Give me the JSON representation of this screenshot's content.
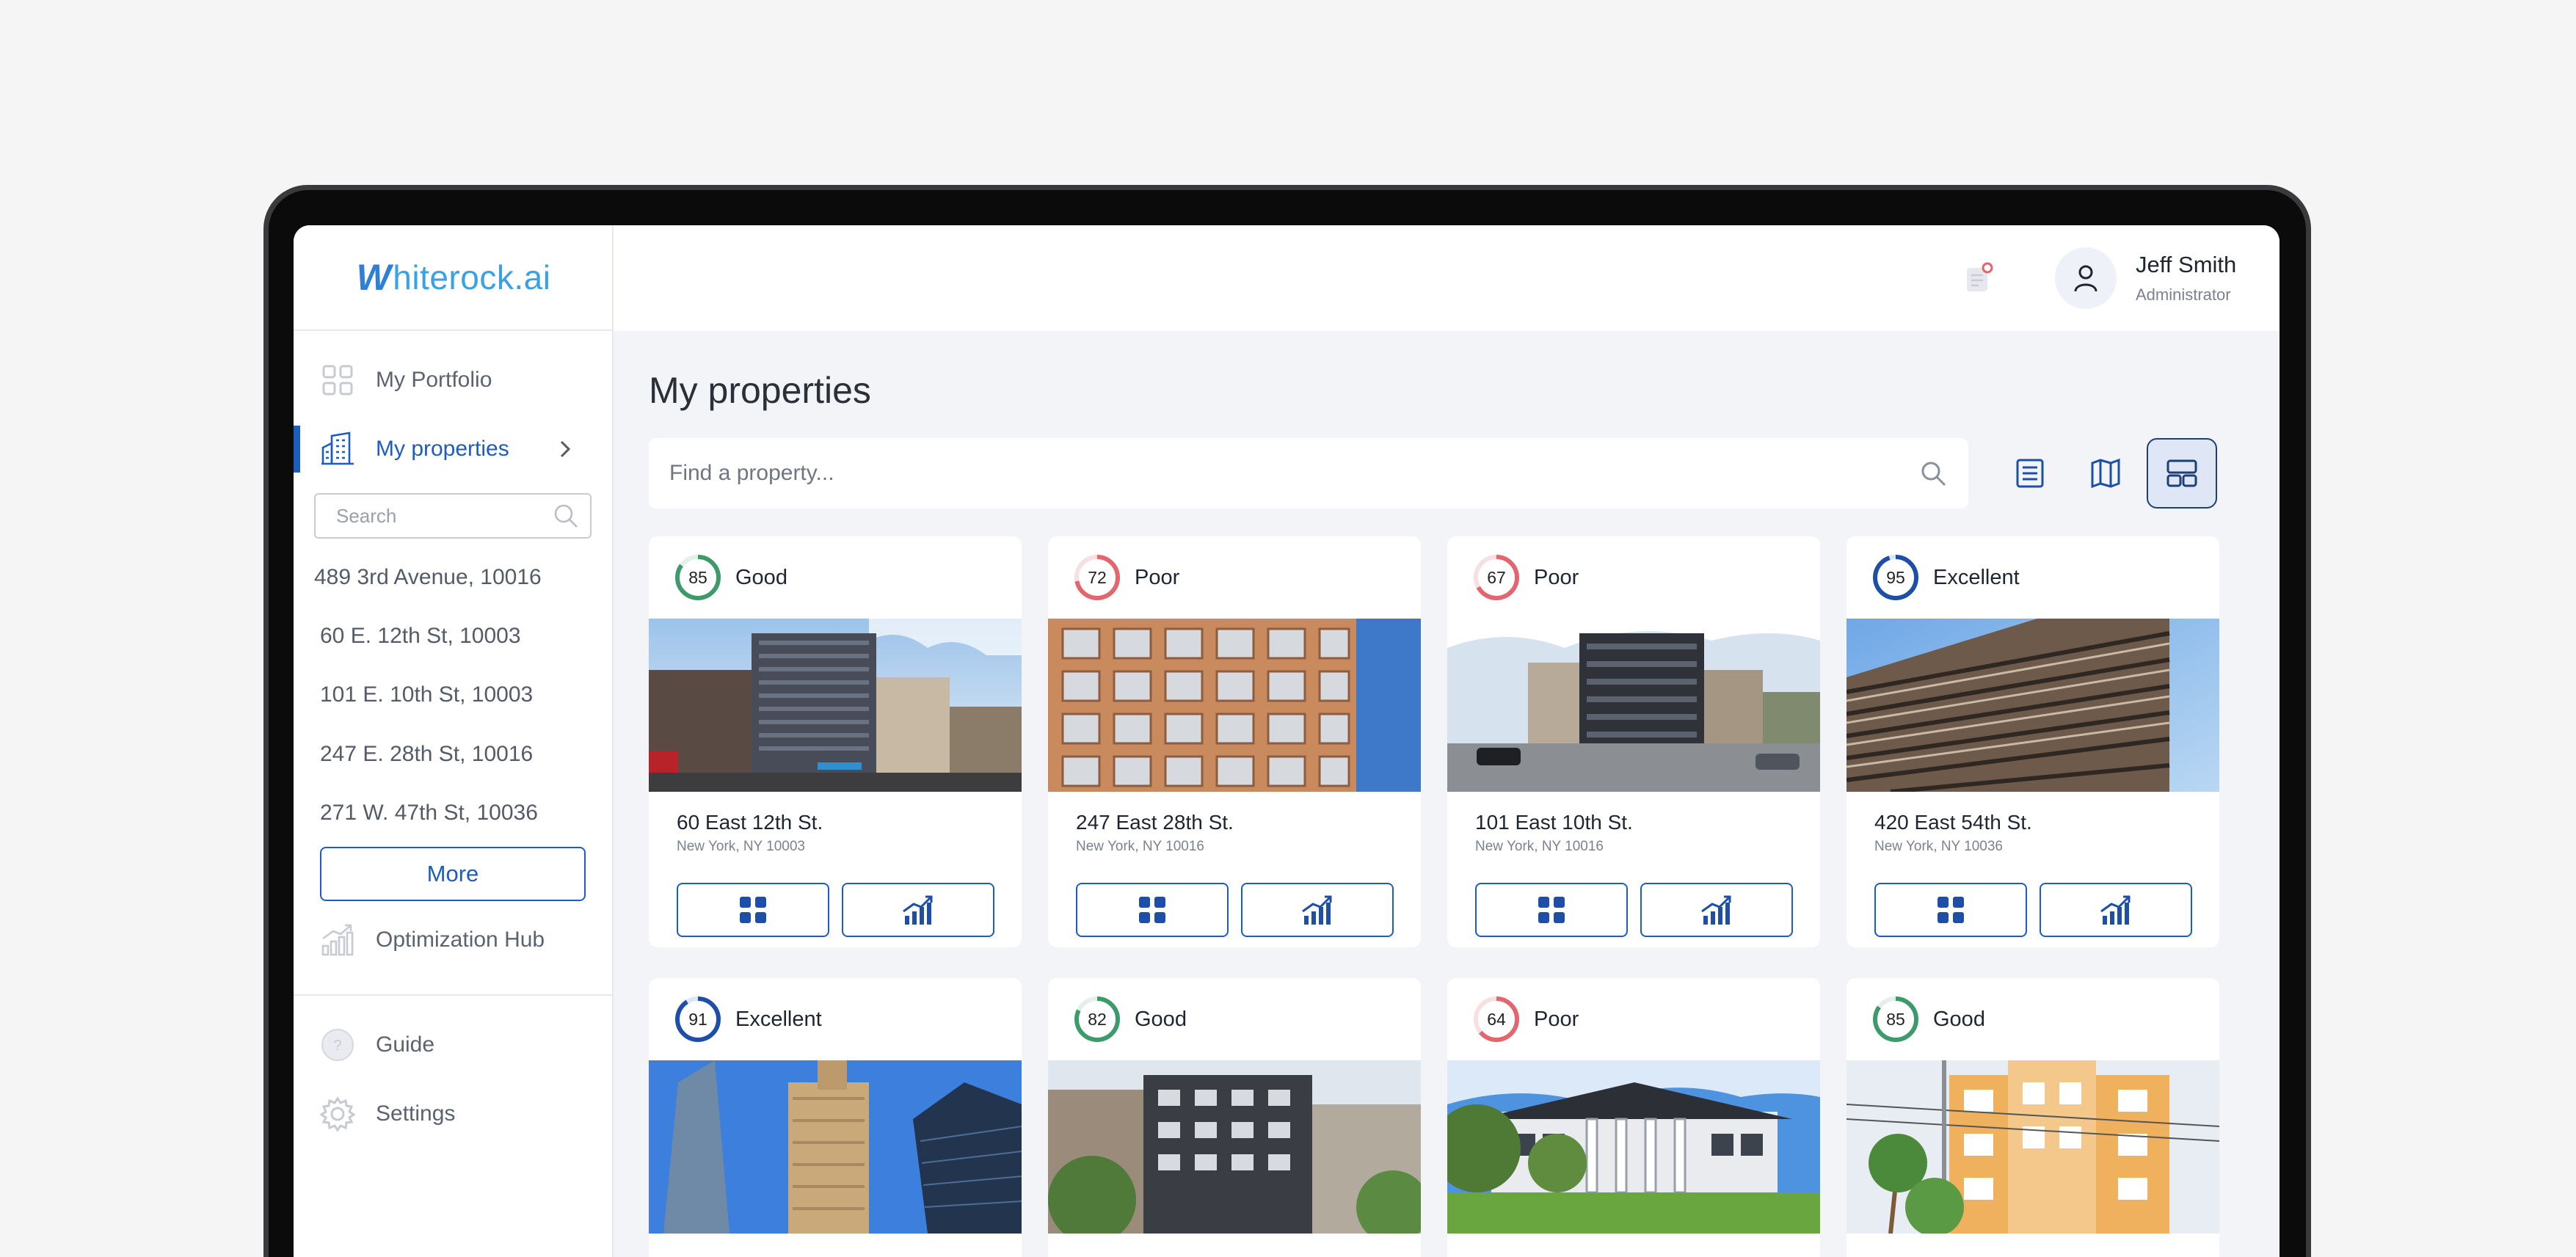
{
  "brand": {
    "logo_mark": "W",
    "logo_text": "hiterock.ai"
  },
  "sidebar": {
    "items": [
      {
        "label": "My Portfolio",
        "icon": "grid-icon"
      },
      {
        "label": "My properties",
        "icon": "building-icon"
      },
      {
        "label": "Optimization Hub",
        "icon": "chart-up-icon"
      },
      {
        "label": "Guide",
        "icon": "help-circle-icon"
      },
      {
        "label": "Settings",
        "icon": "gear-icon"
      }
    ],
    "search_placeholder": "Search",
    "addresses": [
      "489 3rd Avenue, 10016",
      "60 E. 12th St, 10003",
      "101 E. 10th St, 10003",
      "247 E. 28th St, 10016",
      "271 W. 47th St, 10036"
    ],
    "more_label": "More"
  },
  "header": {
    "user_name": "Jeff Smith",
    "user_role": "Administrator"
  },
  "main": {
    "title": "My properties",
    "search_placeholder": "Find a property...",
    "views": [
      "list-view",
      "map-view",
      "card-view"
    ],
    "active_view": "card-view"
  },
  "colors": {
    "accent": "#1d5cc0",
    "good": "#3c9a6b",
    "poor": "#e3666f",
    "excellent": "#1d4fa8"
  },
  "properties": [
    {
      "score": "85",
      "rating": "Good",
      "address": "60 East 12th St.",
      "city": "New York, NY 10003"
    },
    {
      "score": "72",
      "rating": "Poor",
      "address": "247 East 28th St.",
      "city": "New York, NY 10016"
    },
    {
      "score": "67",
      "rating": "Poor",
      "address": "101 East 10th St.",
      "city": "New York, NY 10016"
    },
    {
      "score": "95",
      "rating": "Excellent",
      "address": "420 East 54th St.",
      "city": "New York, NY 10036"
    },
    {
      "score": "91",
      "rating": "Excellent"
    },
    {
      "score": "82",
      "rating": "Good"
    },
    {
      "score": "64",
      "rating": "Poor"
    },
    {
      "score": "85",
      "rating": "Good"
    }
  ]
}
